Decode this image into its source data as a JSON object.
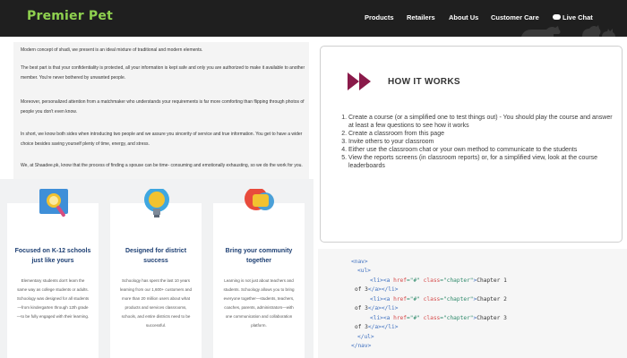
{
  "header": {
    "logo": "Premier Pet",
    "nav": [
      "Products",
      "Retailers",
      "About Us",
      "Customer Care"
    ],
    "live_chat": "Live Chat"
  },
  "article": {
    "paragraphs": [
      "Modern concept of shadi, we present is an ideal mixture of traditional and modern elements.",
      "The best part is that your confidentiality is protected, all your information is kept safe and only you are authorized to make it available to another member. You're never bothered by unwanted people.",
      "Moreover, personalized attention from a matchmaker who understands your requirements is far more comforting than flipping through photos of people you don't even know.",
      "In short, we know both sides when introducing two people and we assure you sincerity of service and true information. You get to have a wider choice besides saving yourself plenty of time, energy, and stress.",
      "We, at Shaadee.pk, know that the process of finding a spouse can be time- consuming and emotionally exhausting, so we do the work for you."
    ]
  },
  "features": [
    {
      "title": "Focused on K-12 schools just like yours",
      "body": "Elementary students don't learn the same way as college students or adults. Schoology was designed for all students—from kindergarten through 12th grade—to be fully engaged with their learning.",
      "icon": "magnifier-icon"
    },
    {
      "title": "Designed for district success",
      "body": "Schoology has spent the last 10 years learning from our 1,600+ customers and more than 20 million users about what products and services classrooms, schools, and entire districts need to be successful.",
      "icon": "lightbulb-icon"
    },
    {
      "title": "Bring your community together",
      "body": "Learning is not just about teachers and students. Schoology allows you to bring everyone together—students, teachers, coaches, parents, administrators—with one communication and collaboration platform.",
      "icon": "chat-bubbles-icon"
    }
  ],
  "how_it_works": {
    "title": "HOW IT WORKS",
    "steps": [
      "Create a course (or a simplified one to test things out) - You should play the course and answer at least a few questions to see how it works",
      "Create a classroom from this page",
      "Invite others to your classroom",
      "Either use the classroom chat or your own method to communicate to the students",
      "View the reports screens (in classroom reports) or, for a simplified view, look at the course leaderboards"
    ]
  },
  "code": {
    "nav_open": "<nav>",
    "ul_open": "<ul>",
    "li_open": "<li>",
    "a_open": "<a",
    "attr_href": "href",
    "href_value": "=\"#\"",
    "attr_class": "class",
    "class_value": "=\"chapter\"",
    "gt": ">",
    "text_prefix": "Chapter",
    "text_suffix": "of 3",
    "numbers": [
      "1",
      "2",
      "3"
    ],
    "a_close": "</a>",
    "li_close": "</li>",
    "ul_close": "</ul>",
    "nav_close": "</nav>"
  },
  "colors": {
    "header_bg": "#1f1f1f",
    "logo_green": "#8fd14f",
    "hiw_accent": "#8a1a4a",
    "code_tag": "#3d6fbf",
    "code_attr": "#d64b4b",
    "code_string": "#2f8a6b"
  }
}
